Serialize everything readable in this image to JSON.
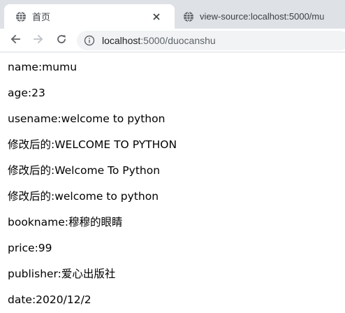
{
  "tabs": [
    {
      "title": "首页",
      "close_label": "✕"
    },
    {
      "title": "view-source:localhost:5000/mu"
    }
  ],
  "omnibox": {
    "url_host": "localhost",
    "url_rest": ":5000/duocanshu"
  },
  "icons": {
    "back": "back-arrow-icon",
    "forward": "forward-arrow-icon",
    "reload": "reload-icon",
    "info": "info-icon",
    "globe": "globe-icon"
  },
  "colors": {
    "tabstrip": "#dee1e6",
    "omnibox": "#f1f3f4",
    "text": "#000000"
  },
  "content": {
    "lines": [
      "name:mumu",
      "age:23",
      "usename:welcome to python",
      "修改后的:WELCOME TO PYTHON",
      "修改后的:Welcome To Python",
      "修改后的:welcome to python",
      "bookname:穆穆的眼睛",
      "price:99",
      "publisher:爱心出版社",
      "date:2020/12/2"
    ]
  }
}
